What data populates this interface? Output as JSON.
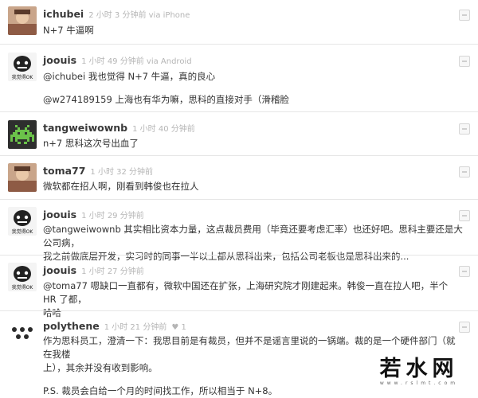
{
  "comments": [
    {
      "author": "ichubei",
      "time": "2 小时 3 分钟前 via iPhone",
      "vote": "",
      "lines": [
        "N+7 牛逼啊"
      ],
      "avatar": "photo-avatar"
    },
    {
      "author": "joouis",
      "time": "1 小时 49 分钟前 via Android",
      "vote": "",
      "lines": [
        "@ichubei 我也觉得 N+7 牛逼，真的良心",
        "",
        "@w274189159 上海也有华为嘛，思科的直接对手（滑稽脸"
      ],
      "avatar": "meme-avatar",
      "avatar_caption": "我觉得OK"
    },
    {
      "author": "tangweiwownb",
      "time": "1 小时 40 分钟前",
      "vote": "",
      "lines": [
        "n+7 思科这次号出血了"
      ],
      "avatar": "pixel-invader-avatar"
    },
    {
      "author": "toma77",
      "time": "1 小时 32 分钟前",
      "vote": "",
      "lines": [
        "微软都在招人啊，刚看到韩俊也在拉人"
      ],
      "avatar": "photo-avatar"
    },
    {
      "author": "joouis",
      "time": "1 小时 29 分钟前",
      "vote": "",
      "lines": [
        "@tangweiwownb 其实相比资本力量，这点裁员费用（毕竟还要考虑汇率）也还好吧。思科主要还是大公司病，",
        "我之前做底层开发，实习时的同事一半以上都从思科出来，包括公司老板也是思科出来的..."
      ],
      "avatar": "meme-avatar",
      "avatar_caption": "我觉得OK"
    },
    {
      "author": "joouis",
      "time": "1 小时 27 分钟前",
      "vote": "",
      "lines": [
        "@toma77 嗯缺口一直都有，微软中国还在扩张，上海研究院才刚建起来。韩俊一直在拉人吧，半个 HR 了都，",
        "哈哈"
      ],
      "avatar": "meme-avatar",
      "avatar_caption": "我觉得OK"
    },
    {
      "author": "polythene",
      "time": "1 小时 21 分钟前",
      "vote": "♥ 1",
      "lines": [
        "作为思科员工，澄清一下：我思目前是有裁员，但并不是谣言里说的一锅端。裁的是一个硬件部门（就在我楼",
        "上），其余并没有收到影响。",
        "",
        "P.S. 裁员会白给一个月的时间找工作，所以相当于 N+8。"
      ],
      "avatar": "dots-avatar"
    }
  ],
  "watermark": {
    "text": "若水网",
    "sub": "www.rslmt.com"
  },
  "colors": {
    "author": "#3a3a3a",
    "meta": "#b5b5b5",
    "body": "#333333",
    "divider": "#e6e6e6"
  }
}
